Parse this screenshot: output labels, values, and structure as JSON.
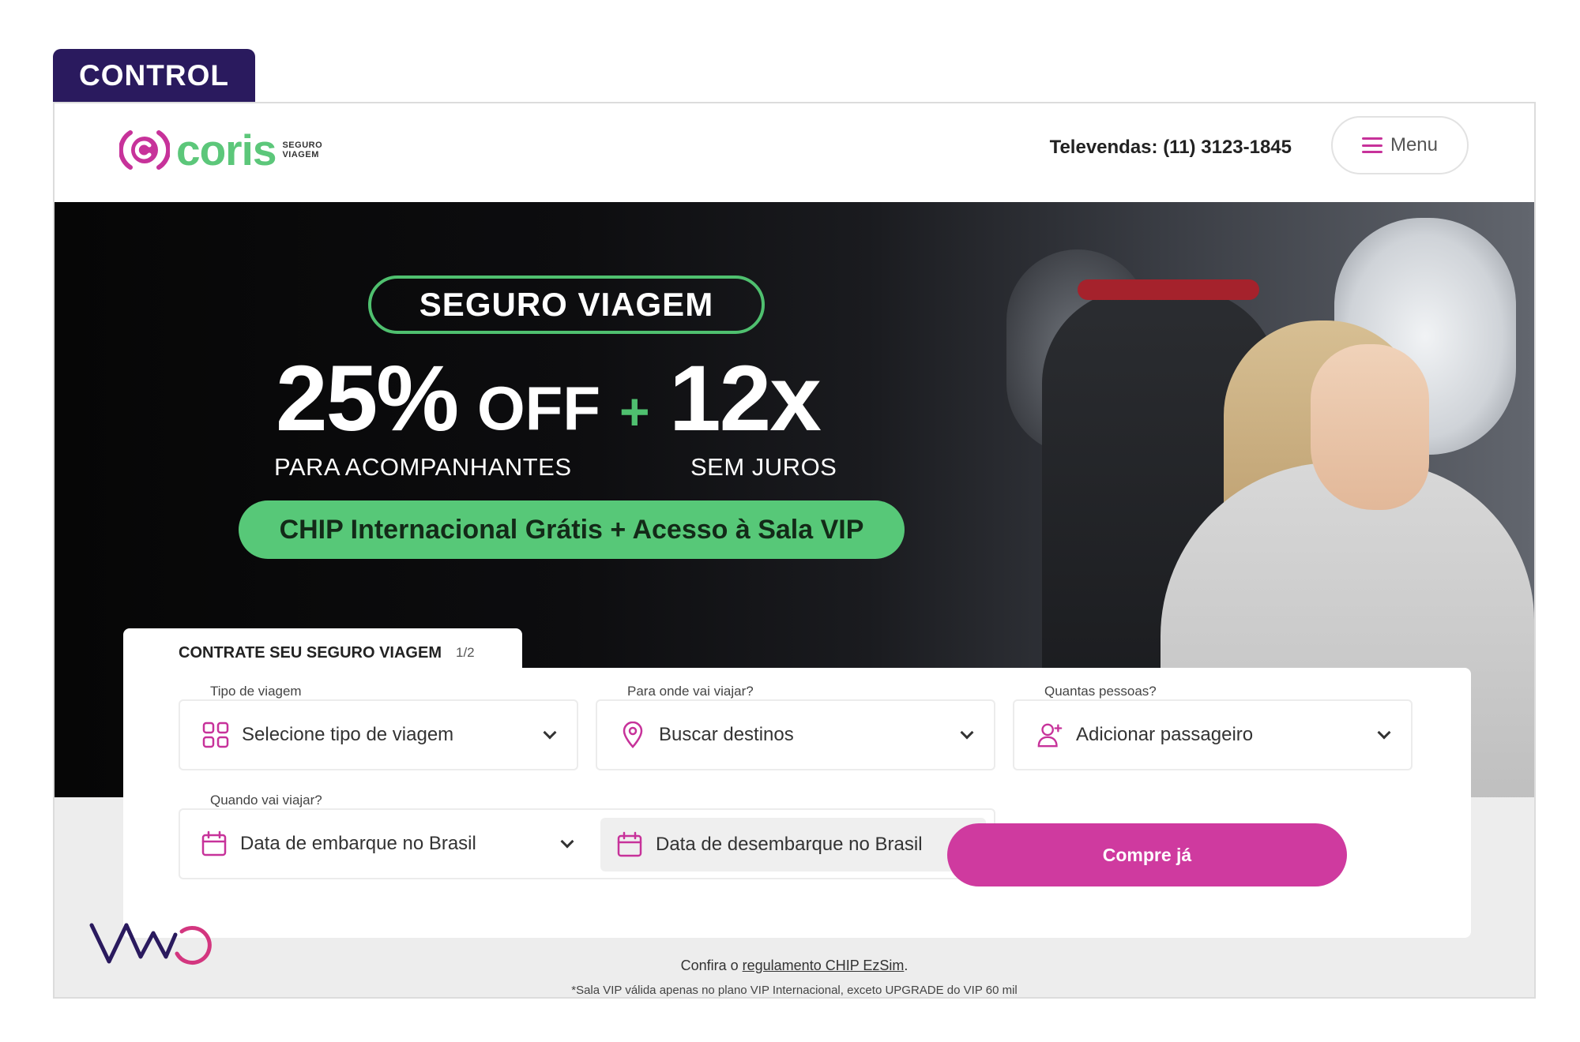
{
  "variant_tag": "CONTROL",
  "header": {
    "logo_word": "coris",
    "logo_sub_1": "SEGURO",
    "logo_sub_2": "VIAGEM",
    "phone": "Televendas: (11) 3123-1845",
    "menu_label": "Menu"
  },
  "hero": {
    "badge": "SEGURO VIAGEM",
    "discount": "25%",
    "off": "OFF",
    "plus": "+",
    "installments": "12x",
    "discount_sub": "PARA ACOMPANHANTES",
    "installments_sub": "SEM JUROS",
    "perks": "CHIP Internacional Grátis + Acesso à Sala VIP"
  },
  "booking": {
    "tab_title": "CONTRATE SEU SEGURO VIAGEM",
    "tab_step": "1/2",
    "trip_type": {
      "label": "Tipo de viagem",
      "value": "Selecione tipo de viagem"
    },
    "destination": {
      "label": "Para onde vai viajar?",
      "value": "Buscar destinos"
    },
    "passengers": {
      "label": "Quantas pessoas?",
      "value": "Adicionar passageiro"
    },
    "dates": {
      "label": "Quando vai viajar?",
      "departure": "Data de embarque no Brasil",
      "return": "Data de desembarque no Brasil"
    },
    "buy_button": "Compre já"
  },
  "footer": {
    "line1_prefix": "Confira o ",
    "line1_link": "regulamento CHIP EzSim",
    "line1_suffix": ".",
    "line2": "*Sala VIP válida apenas no plano VIP Internacional, exceto UPGRADE do VIP 60 mil"
  },
  "branding": {
    "watermark": "VWO"
  },
  "colors": {
    "brand_green": "#4fc06f",
    "brand_magenta": "#cf3a9f",
    "tag_purple": "#2a1a5e"
  }
}
